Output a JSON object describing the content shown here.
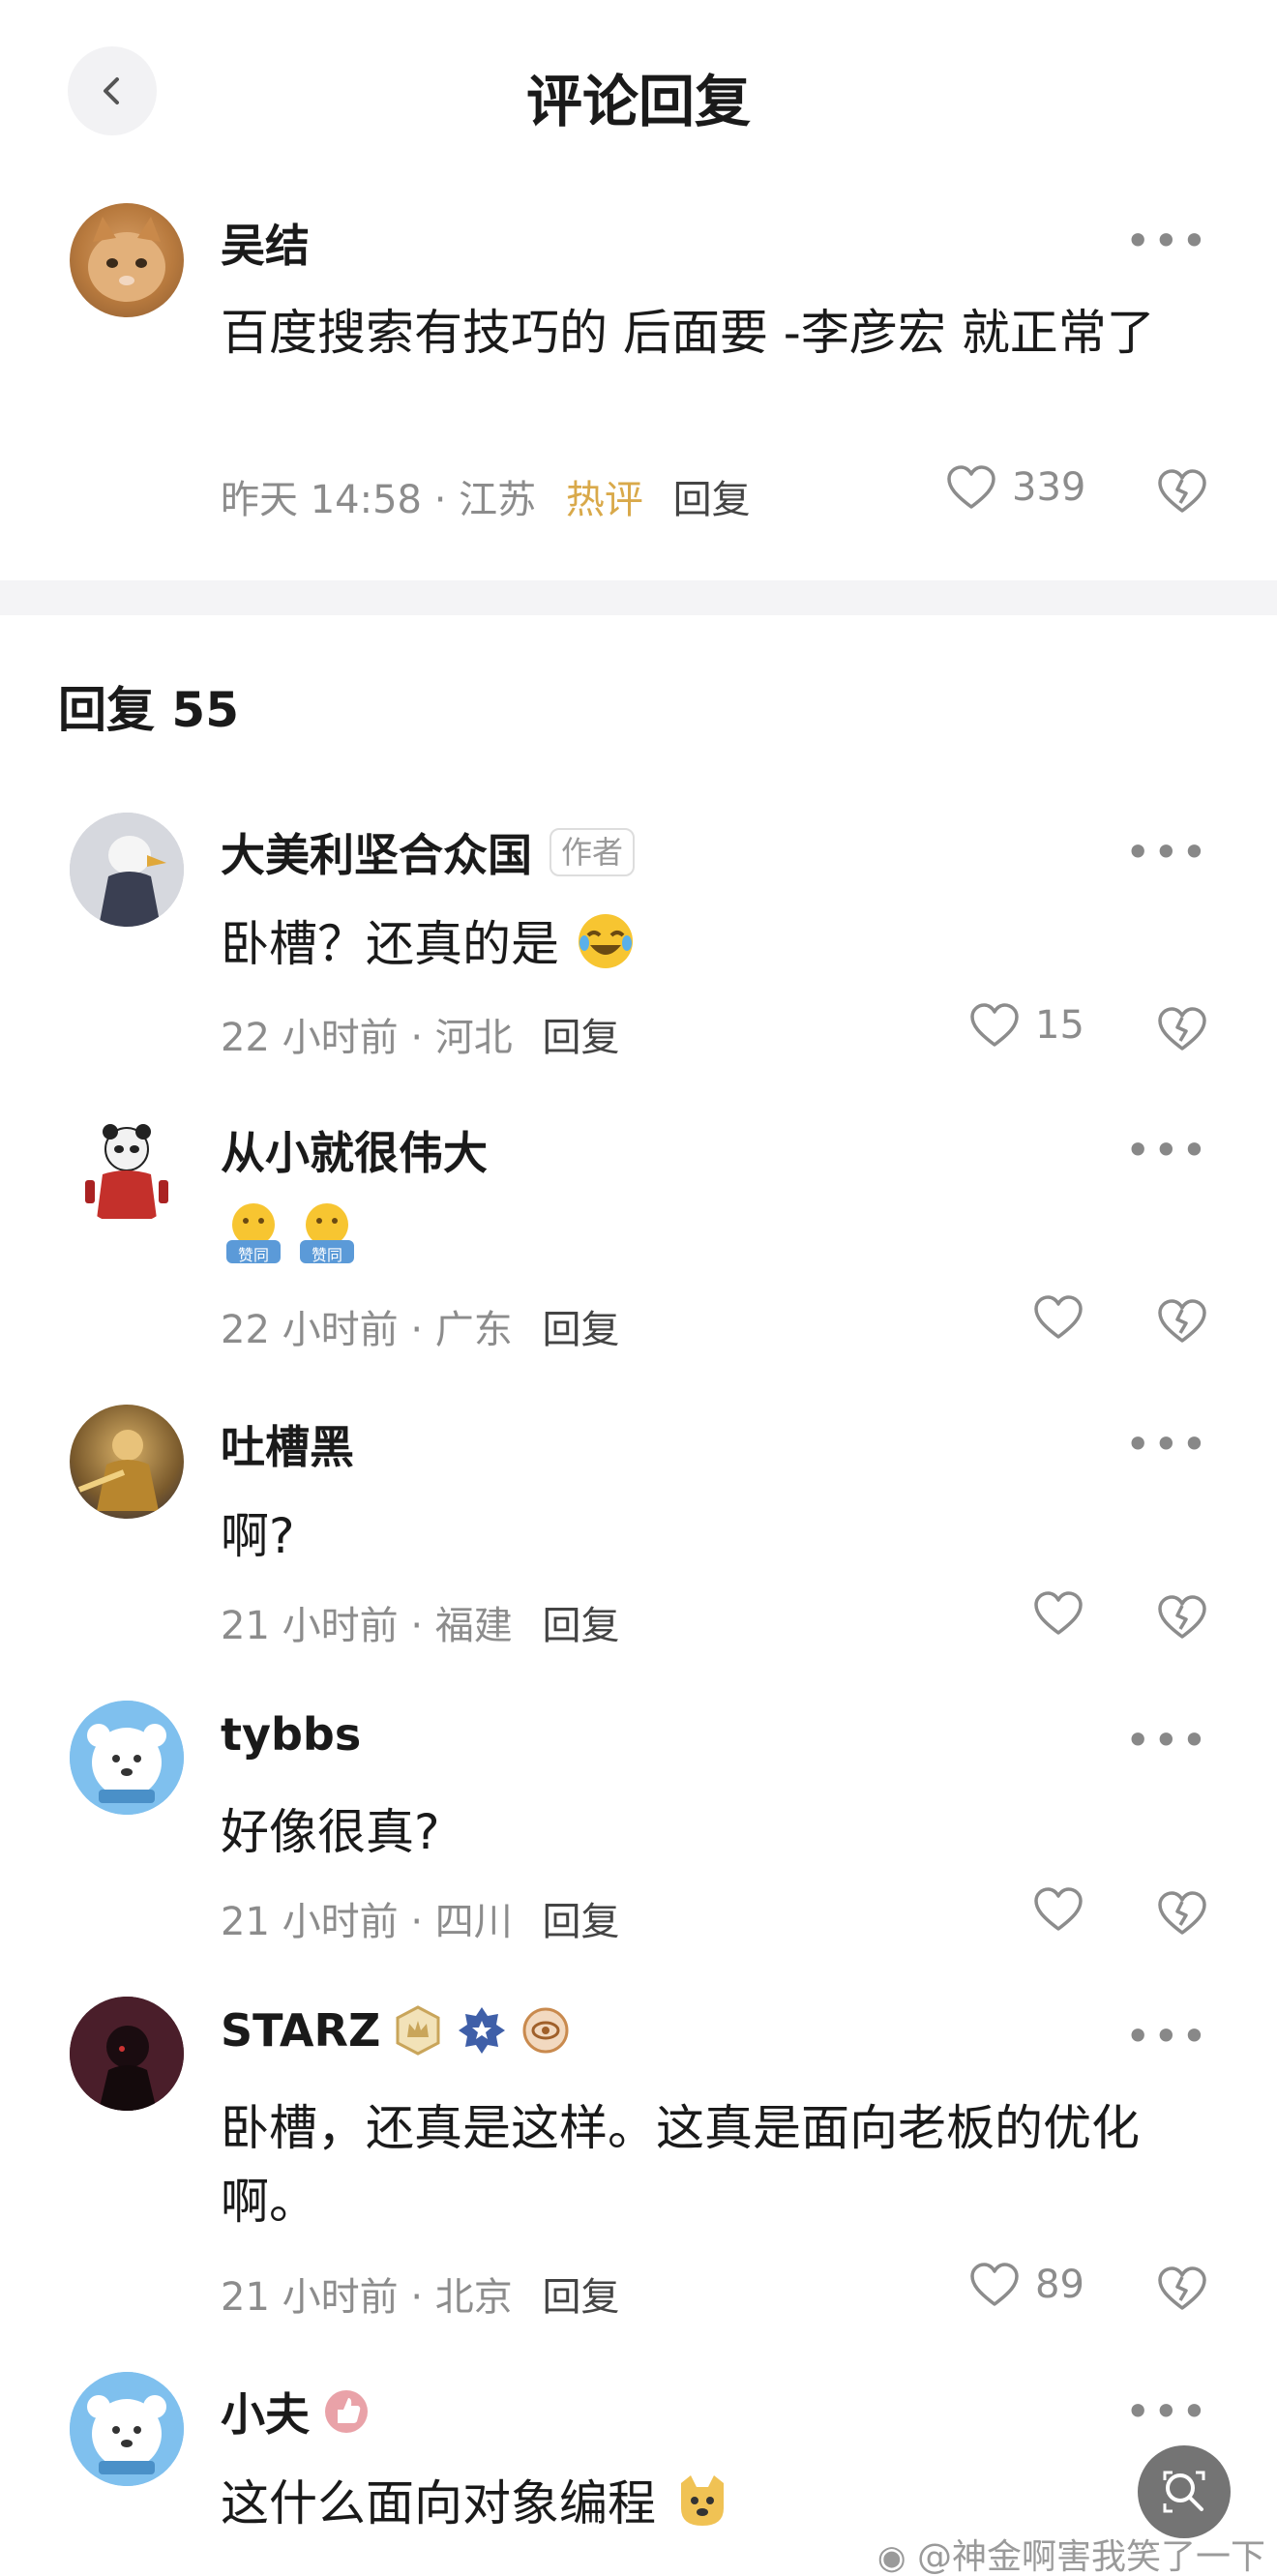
{
  "header": {
    "title": "评论回复"
  },
  "main_comment": {
    "user": "吴结",
    "text": "百度搜索有技巧的 后面要 -李彦宏 就正常了",
    "time": "昨天 14:58",
    "location": "江苏",
    "hot_label": "热评",
    "reply_label": "回复",
    "likes": "339"
  },
  "replies_header": "回复 55",
  "replies": [
    {
      "user": "大美利坚合众国",
      "badge": "作者",
      "text": "卧槽？还真的是",
      "time": "22 小时前",
      "location": "河北",
      "reply_label": "回复",
      "likes": "15"
    },
    {
      "user": "从小就很伟大",
      "text": "",
      "sticker_label": "赞同",
      "time": "22 小时前",
      "location": "广东",
      "reply_label": "回复",
      "likes": ""
    },
    {
      "user": "吐槽黑",
      "text": "啊?",
      "time": "21 小时前",
      "location": "福建",
      "reply_label": "回复",
      "likes": ""
    },
    {
      "user": "tybbs",
      "text": "好像很真?",
      "time": "21 小时前",
      "location": "四川",
      "reply_label": "回复",
      "likes": ""
    },
    {
      "user": "STARZ",
      "text": "卧槽，还真是这样。这真是面向老板的优化啊。",
      "time": "21 小时前",
      "location": "北京",
      "reply_label": "回复",
      "likes": "89"
    },
    {
      "user": "小夫",
      "text": "这什么面向对象编程"
    }
  ],
  "watermark": "@神金啊害我笑了一下",
  "colors": {
    "hot": "#d9a94a",
    "meta": "#8c8c8c",
    "divider": "#f4f4f6"
  }
}
